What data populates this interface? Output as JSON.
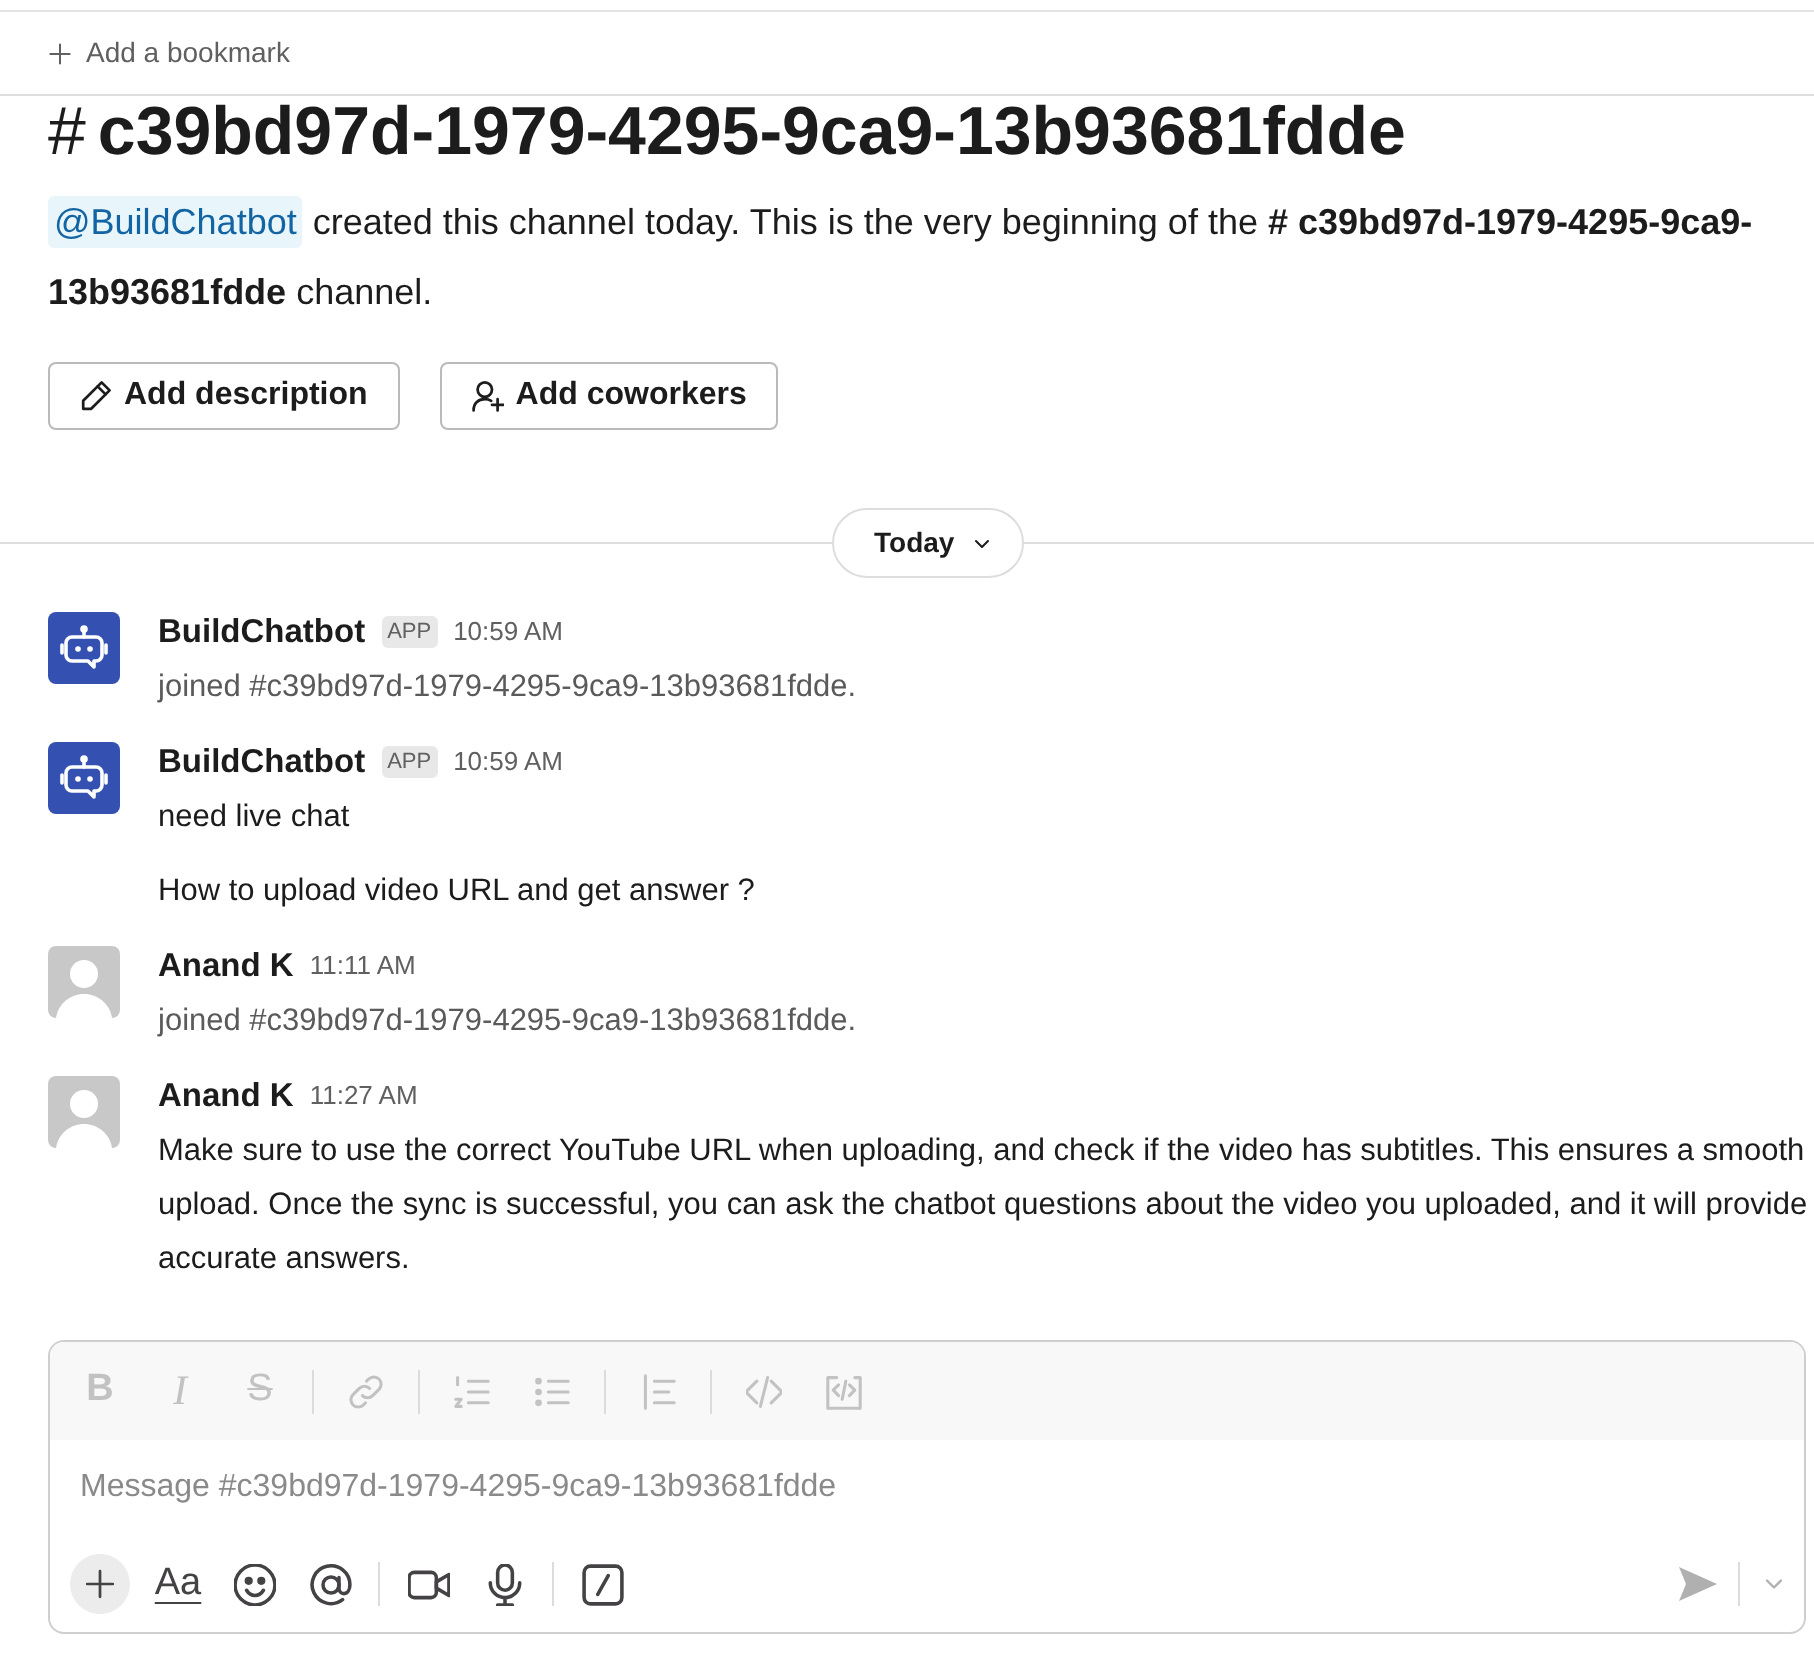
{
  "bookmark_bar": {
    "label": "Add a bookmark"
  },
  "channel_header": {
    "hash": "#",
    "name": "c39bd97d-1979-4295-9ca9-13b93681fdde",
    "intro_mention": "@BuildChatbot",
    "intro_text": "created this channel today. This is the very beginning of the **# c39bd97d-1979-4295-9ca9-13b93681fdde** channel.",
    "actions": [
      {
        "kind": "pencil",
        "label": "Add description"
      },
      {
        "kind": "person-add",
        "label": "Add coworkers"
      }
    ]
  },
  "date_divider": {
    "label": "Today"
  },
  "messages": [
    {
      "avatar": {
        "kind": "bot"
      },
      "sender": "BuildChatbot",
      "badge": "APP",
      "time": "10:59 AM",
      "kind": "system",
      "paragraphs": [
        "joined #c39bd97d-1979-4295-9ca9-13b93681fdde."
      ]
    },
    {
      "avatar": {
        "kind": "bot"
      },
      "sender": "BuildChatbot",
      "badge": "APP",
      "time": "10:59 AM",
      "kind": "text",
      "paragraphs": [
        "need live chat",
        "How to upload video URL and get answer ?"
      ]
    },
    {
      "avatar": {
        "kind": "person"
      },
      "sender": "Anand K",
      "time": "11:11 AM",
      "kind": "system",
      "paragraphs": [
        "joined #c39bd97d-1979-4295-9ca9-13b93681fdde."
      ]
    },
    {
      "avatar": {
        "kind": "person"
      },
      "sender": "Anand K",
      "time": "11:27 AM",
      "kind": "text",
      "paragraphs": [
        "Make sure to use the correct YouTube URL when uploading, and check if the video has subtitles. This ensures a smooth upload. Once the sync is successful, you can ask the chatbot questions about the video you uploaded, and it will provide accurate answers."
      ]
    }
  ],
  "composer": {
    "formatting_toolbar": {
      "disabled": true,
      "groups": [
        [
          {
            "kind": "bold",
            "glyph": "B"
          },
          {
            "kind": "italic",
            "glyph": "I"
          },
          {
            "kind": "strike",
            "glyph": "S"
          }
        ],
        [
          {
            "kind": "link"
          }
        ],
        [
          {
            "kind": "ordered-list"
          },
          {
            "kind": "bullet-list"
          }
        ],
        [
          {
            "kind": "quote"
          }
        ],
        [
          {
            "kind": "code"
          },
          {
            "kind": "code-block"
          }
        ]
      ]
    },
    "placeholder": "Message #c39bd97d-1979-4295-9ca9-13b93681fdde",
    "tool_groups": [
      [
        {
          "kind": "plus"
        },
        {
          "kind": "format",
          "glyph": "Aa"
        },
        {
          "kind": "emoji"
        },
        {
          "kind": "mention"
        }
      ],
      [
        {
          "kind": "video"
        },
        {
          "kind": "mic"
        }
      ],
      [
        {
          "kind": "slash"
        }
      ]
    ],
    "send": {
      "disabled": true
    }
  }
}
